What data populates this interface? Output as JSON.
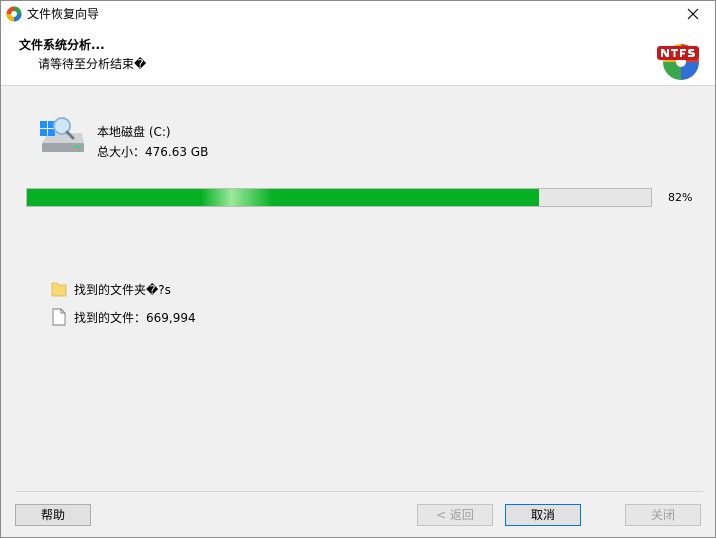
{
  "window": {
    "title": "文件恢复向导"
  },
  "header": {
    "title": "文件系统分析...",
    "subtitle": "请等待至分析结束�"
  },
  "drive": {
    "name": "本地磁盘 (C:)",
    "size": "总大小：476.63 GB"
  },
  "progress": {
    "value": 0.82,
    "label": "82%"
  },
  "found": {
    "folders": "找到的文件夹�?s",
    "files": "找到的文件：669,994"
  },
  "buttons": {
    "help": "帮助",
    "back": "< 返回",
    "cancel": "取消",
    "close": "关闭"
  },
  "icons": {
    "app": "app-icon",
    "close": "close-icon",
    "logo": "ntfs-logo-icon",
    "drive": "drive-icon",
    "folder": "folder-icon",
    "file": "file-icon"
  },
  "colors": {
    "progress": "#06b025",
    "primary_border": "#0078d7"
  }
}
